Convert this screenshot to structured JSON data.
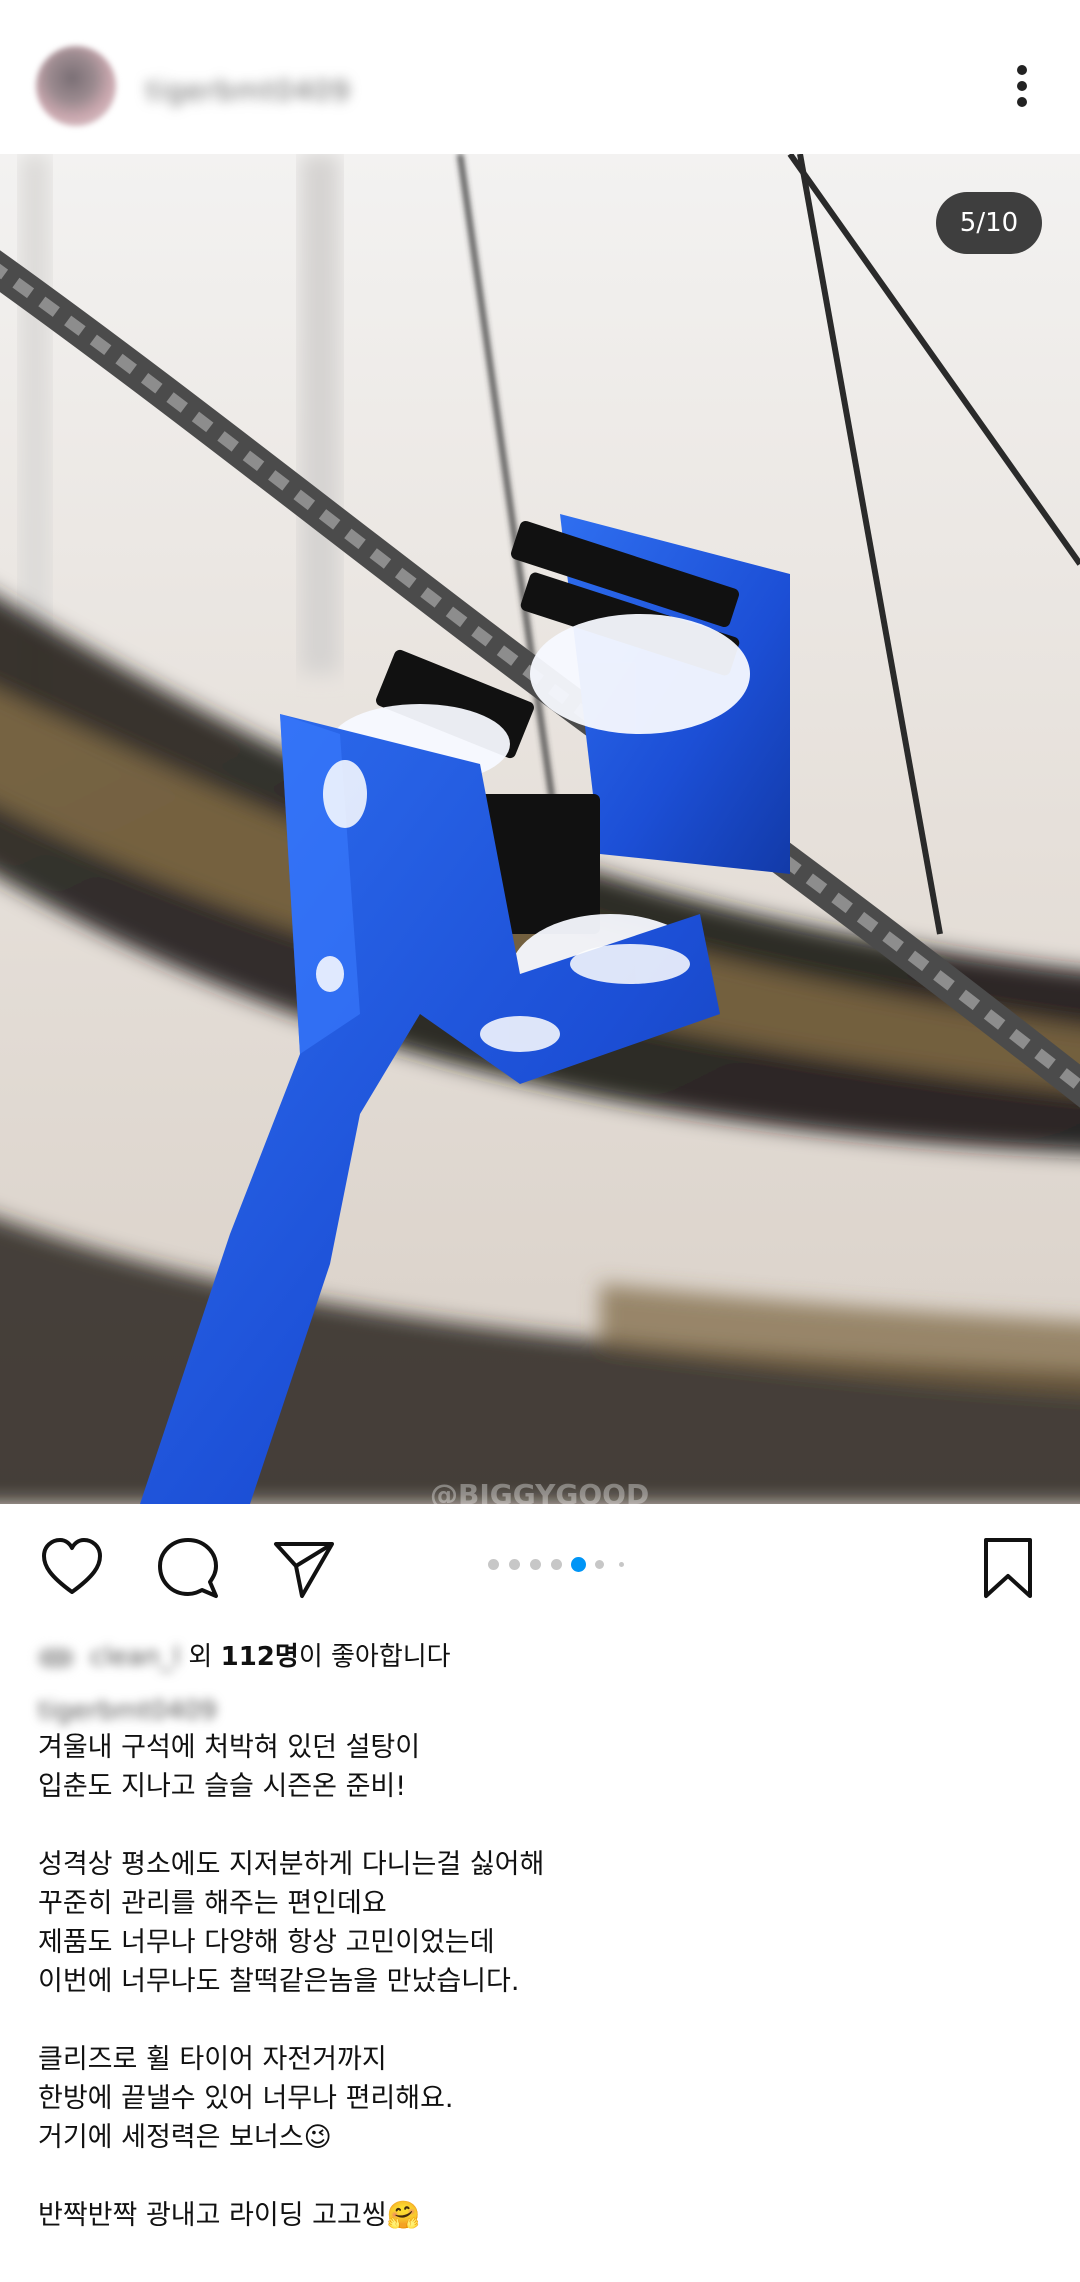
{
  "header": {
    "username": "tigerbmt0409",
    "menu_icon": "more-vertical-icon"
  },
  "post": {
    "counter": "5/10",
    "carousel": {
      "total_dots": 7,
      "active_dot": 5
    },
    "watermark": "@BIGGYGOOD"
  },
  "actions": {
    "like_icon": "heart-icon",
    "comment_icon": "comment-icon",
    "share_icon": "send-icon",
    "save_icon": "bookmark-icon",
    "accent": "#0095f6"
  },
  "likes": {
    "liker": "clean_l",
    "prefix": "외 ",
    "count": "112명",
    "suffix": "이 좋아합니다"
  },
  "caption": {
    "username": "tigerbmt0409",
    "text": "겨울내 구석에 처박혀 있던 설탕이\n입춘도 지나고 슬슬 시즌온 준비!\n\n성격상 평소에도 지저분하게 다니는걸 싫어해\n꾸준히 관리를 해주는 편인데요\n제품도 너무나 다양해 항상 고민이었는데\n이번에 너무나도 찰떡같은놈을 만났습니다.\n\n클리즈로 휠 타이어 자전거까지\n한방에 끝낼수 있어 너무나 편리해요.\n거기에 세정력은 보너스😉\n\n반짝반짝 광내고 라이딩 고고씽🤗"
  }
}
